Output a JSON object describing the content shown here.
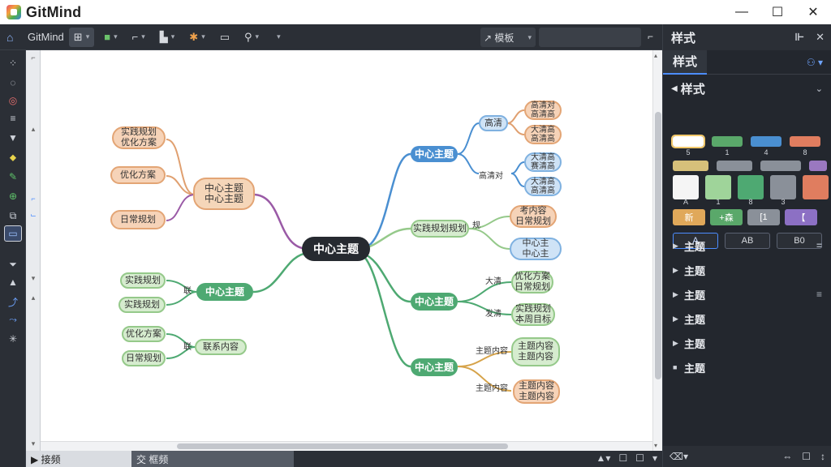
{
  "window": {
    "title": "GitMind",
    "controls": [
      "—",
      "☐",
      "✕"
    ]
  },
  "toolbar": {
    "doc_name": "GitMind",
    "search_label": "↗ 模板",
    "icons": [
      "layout-icon",
      "theme-icon",
      "frame-icon",
      "structure-icon",
      "color-icon",
      "outline-icon",
      "share-icon",
      "more-icon"
    ]
  },
  "right_panel": {
    "header": "样式",
    "tab": "样式",
    "section": "样式",
    "swatches_row1": [
      "#ffffff",
      "#5aa86a",
      "#4a8fd1",
      "#e07d5f"
    ],
    "swatch_labels_row1": [
      "5",
      "1",
      "4",
      "8"
    ],
    "swatches_row2": [
      "#d6c07a",
      "#8a9099",
      "#8a9099",
      "#9a78c0"
    ],
    "big_swatches": [
      "#f5f5f5",
      "#9fd49a",
      "#4ea972",
      "#8a9099",
      "#e07d5f"
    ],
    "big_labels": [
      "A",
      "1",
      "8",
      "3"
    ],
    "chips": [
      {
        "label": "新",
        "color": "#e0a85a"
      },
      {
        "label": "+森",
        "color": "#5aa86a"
      },
      {
        "label": "[1",
        "color": "#8a9099"
      },
      {
        "label": "【",
        "color": "#8c70c4"
      }
    ],
    "buttons": [
      "A",
      "AB",
      "B0"
    ],
    "topics": [
      "主题",
      "主题",
      "主题",
      "主题",
      "主题",
      "主题"
    ],
    "topic_icons": [
      "=",
      "",
      "≡",
      "",
      "",
      ""
    ],
    "bottom_left": "⌫▾",
    "bottom_right": [
      "⇔",
      "☐",
      "↕"
    ]
  },
  "statusbar": {
    "tab1": "▶ 接频",
    "tab2": "交 框频",
    "right_icons": [
      "▲▾",
      "☐",
      "☐",
      "▾"
    ]
  },
  "mindmap": {
    "center": "中心主题",
    "branches": {
      "top_right": "中心主题",
      "top_right_child1": "高清",
      "top_right_child2": "高清对",
      "top_right_leaf1": "高清对\n高清高",
      "top_right_leaf2": "大清高\n高清高",
      "top_right_leaf3": "大清高\n赛清高",
      "top_right_leaf4": "大清高\n高清高",
      "mid_right": "实践规划规划",
      "mid_right_label": "规",
      "mid_right_leaf1": "考内容\n日常规划",
      "mid_right_leaf2": "中心主\n中心主",
      "green_right1": "中心主题",
      "green_right1_l1": "大清",
      "green_right1_l2": "发清",
      "green_right1_leaf1": "优化方案\n日常规划",
      "green_right1_leaf2": "实践规划\n本周目标",
      "green_right2": "中心主题",
      "green_right2_l1": "主题内容",
      "green_right2_l2": "主题内容",
      "green_right2_leaf1": "主题内容\n主题内容",
      "green_right2_leaf2": "主题内容\n主题内容",
      "left_top": "中心主题\n中心主题",
      "left_top_leaf1": "实践规划\n优化方案",
      "left_top_leaf2": "优化方案",
      "left_top_leaf3": "日常规划",
      "left_mid": "中心主题",
      "left_mid_label": "联",
      "left_mid_leaf1": "实践规划",
      "left_mid_leaf2": "实践规划",
      "left_bot": "联系内容",
      "left_bot_label": "联",
      "left_bot_leaf1": "优化方案",
      "left_bot_leaf2": "日常规划"
    }
  }
}
